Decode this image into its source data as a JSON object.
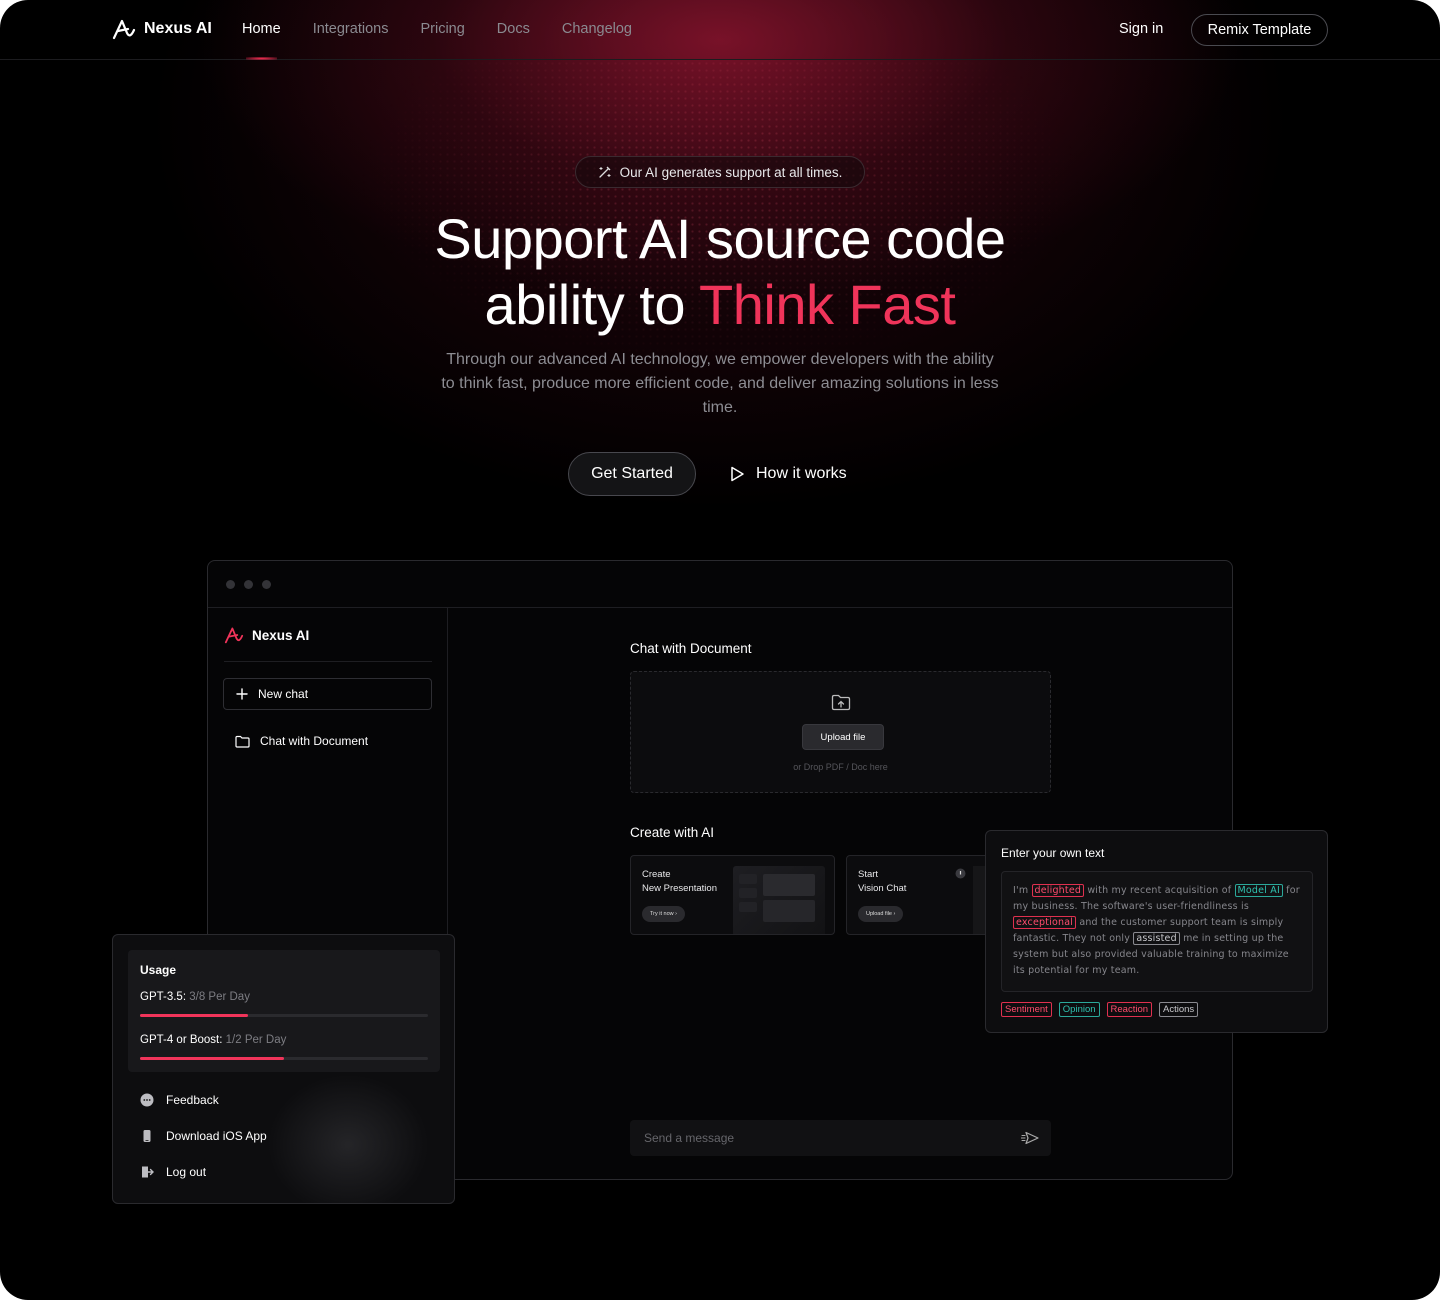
{
  "nav": {
    "brand": "Nexus AI",
    "links": [
      "Home",
      "Integrations",
      "Pricing",
      "Docs",
      "Changelog"
    ],
    "sign_in": "Sign in",
    "remix": "Remix Template"
  },
  "hero": {
    "badge": "Our AI generates support at all times.",
    "headline_line1": "Support AI source code",
    "headline_line2_plain": "ability to ",
    "headline_line2_accent": "Think Fast",
    "subtitle": "Through our advanced AI technology, we empower developers with the ability to think fast, produce more efficient code, and deliver amazing solutions in less time.",
    "get_started": "Get Started",
    "how_it_works": "How it works"
  },
  "app": {
    "sidebar": {
      "brand": "Nexus AI",
      "new_chat": "New chat",
      "items": [
        "Chat with Document"
      ]
    },
    "chat_doc": {
      "heading": "Chat with Document",
      "upload_label": "Upload file",
      "drop_hint": "or Drop PDF / Doc here"
    },
    "create": {
      "heading": "Create with AI",
      "cards": [
        {
          "line1": "Create",
          "line2": "New Presentation",
          "button": "Try it now"
        },
        {
          "line1": "Start",
          "line2": "Vision Chat",
          "button": "Upload file"
        }
      ]
    },
    "send_placeholder": "Send a message"
  },
  "usage": {
    "title": "Usage",
    "rows": [
      {
        "label": "GPT-3.5:",
        "value": "3/8 Per Day",
        "fraction": 0.375
      },
      {
        "label": "GPT-4 or Boost:",
        "value": "1/2 Per Day",
        "fraction": 0.5
      }
    ],
    "links": [
      "Feedback",
      "Download iOS App",
      "Log out"
    ]
  },
  "text_panel": {
    "title": "Enter your own text",
    "body": {
      "t1": "I'm ",
      "h1": "delighted",
      "t2": " with my recent acquisition of ",
      "h2": "Model AI",
      "t3": " for my business. The software's user-friendliness is ",
      "h3": "exceptional",
      "t4": " and the customer support team is simply fantastic. They not only ",
      "h4": "assisted",
      "t5": " me in setting up the system but also provided valuable training to maximize its potential for my team."
    },
    "tags": [
      "Sentiment",
      "Opinion",
      "Reaction",
      "Actions"
    ]
  },
  "colors": {
    "accent": "#f0345a",
    "teal": "#2fc2b0",
    "background": "#000000"
  }
}
